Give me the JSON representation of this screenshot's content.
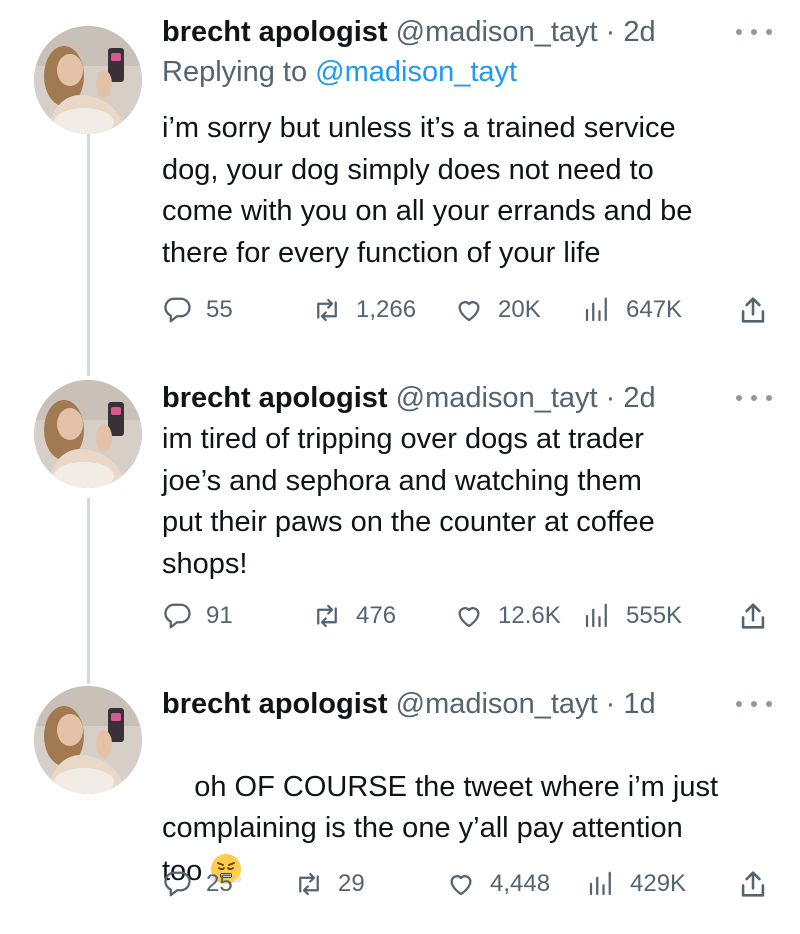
{
  "tweets": [
    {
      "name": "brecht apologist",
      "handle": "@madison_tayt",
      "separator": "·",
      "time": "2d",
      "replying_prefix": "Replying to",
      "replying_handle": "@madison_tayt",
      "text": "i’m sorry but unless it’s a trained service\ndog, your dog simply does not need to\ncome with you on all your errands and be\nthere for every function of your life",
      "replies": "55",
      "retweets": "1,266",
      "likes": "20K",
      "views": "647K"
    },
    {
      "name": "brecht apologist",
      "handle": "@madison_tayt",
      "separator": "·",
      "time": "2d",
      "text": "im tired of tripping over dogs at trader\njoe’s and sephora and watching them\nput their paws on the counter at coffee\nshops!",
      "replies": "91",
      "retweets": "476",
      "likes": "12.6K",
      "views": "555K"
    },
    {
      "name": "brecht apologist",
      "handle": "@madison_tayt",
      "separator": "·",
      "time": "1d",
      "text": "oh OF COURSE the tweet where i’m just\ncomplaining is the one y’all pay attention\ntoo",
      "emoji": "face-with-steam-icon",
      "replies": "25",
      "retweets": "29",
      "likes": "4,448",
      "views": "429K"
    }
  ],
  "colors": {
    "text": "#0f1419",
    "secondary": "#536471",
    "link": "#1d9bf0",
    "thread_line": "#cfd9de"
  }
}
